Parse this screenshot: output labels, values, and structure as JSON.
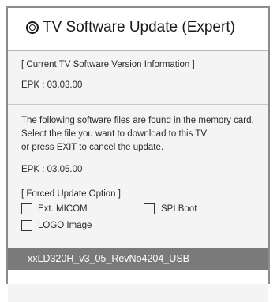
{
  "dialog": {
    "title": "TV Software Update (Expert)",
    "title_icon": "radio-circle-icon"
  },
  "current_info": {
    "header": "[ Current TV Software Version Information ]",
    "epk": "EPK : 03.03.00"
  },
  "found_files": {
    "line1": "The following software files are found in the memory card.",
    "line2": "Select the file you want to download to this TV",
    "line3": "or press EXIT to cancel the update.",
    "epk": "EPK : 03.05.00"
  },
  "forced_update": {
    "header": "[ Forced Update Option ]",
    "options": [
      {
        "label": "Ext. MICOM",
        "checked": false
      },
      {
        "label": "SPI Boot",
        "checked": false
      },
      {
        "label": "LOGO Image",
        "checked": false
      }
    ]
  },
  "file_list": {
    "items": [
      "xxLD320H_v3_05_RevNo4204_USB"
    ],
    "selected_index": 0
  },
  "colors": {
    "selected_bg": "#7a7a7a",
    "frame": "#8c8c8c"
  }
}
